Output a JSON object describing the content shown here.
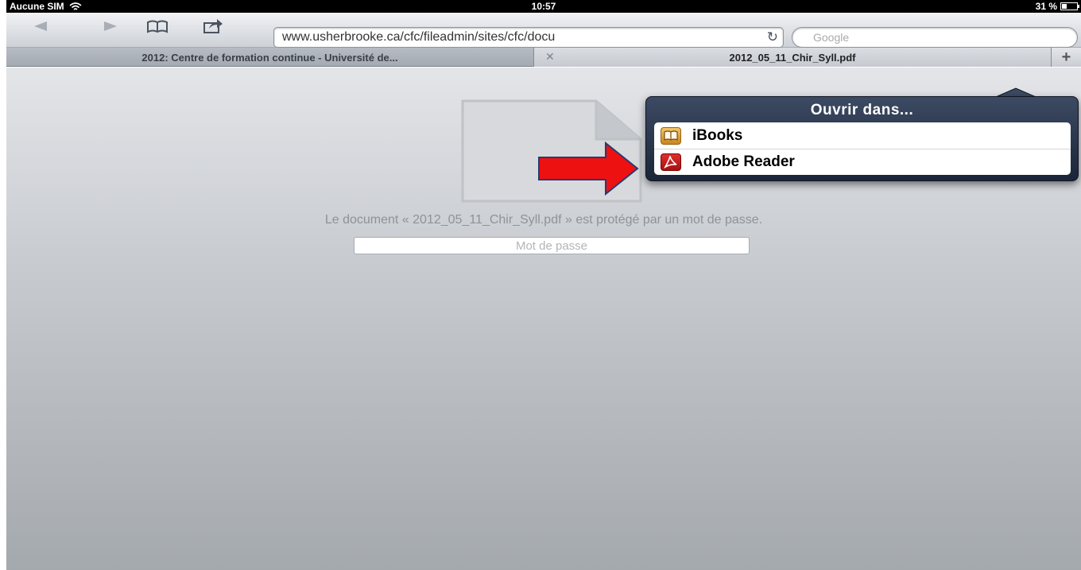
{
  "status_bar": {
    "carrier": "Aucune SIM",
    "time": "10:57",
    "battery": "31 %",
    "battery_level": 0.31
  },
  "toolbar": {
    "url": "www.usherbrooke.ca/cfc/fileadmin/sites/cfc/docu",
    "search_placeholder": "Google"
  },
  "tabs": [
    {
      "label": "2012: Centre de formation continue - Université de...",
      "active": false
    },
    {
      "label": "2012_05_11_Chir_Syll.pdf",
      "active": true
    }
  ],
  "content": {
    "locked_message": "Le document « 2012_05_11_Chir_Syll.pdf » est protégé par un mot de passe.",
    "password_placeholder": "Mot de passe"
  },
  "popover": {
    "title": "Ouvrir dans...",
    "items": [
      {
        "label": "iBooks",
        "icon": "ibooks-icon"
      },
      {
        "label": "Adobe Reader",
        "icon": "adobe-reader-icon"
      }
    ]
  },
  "colors": {
    "annotation_arrow": "#ee1111",
    "popover_bg": "#1f2a3f"
  }
}
